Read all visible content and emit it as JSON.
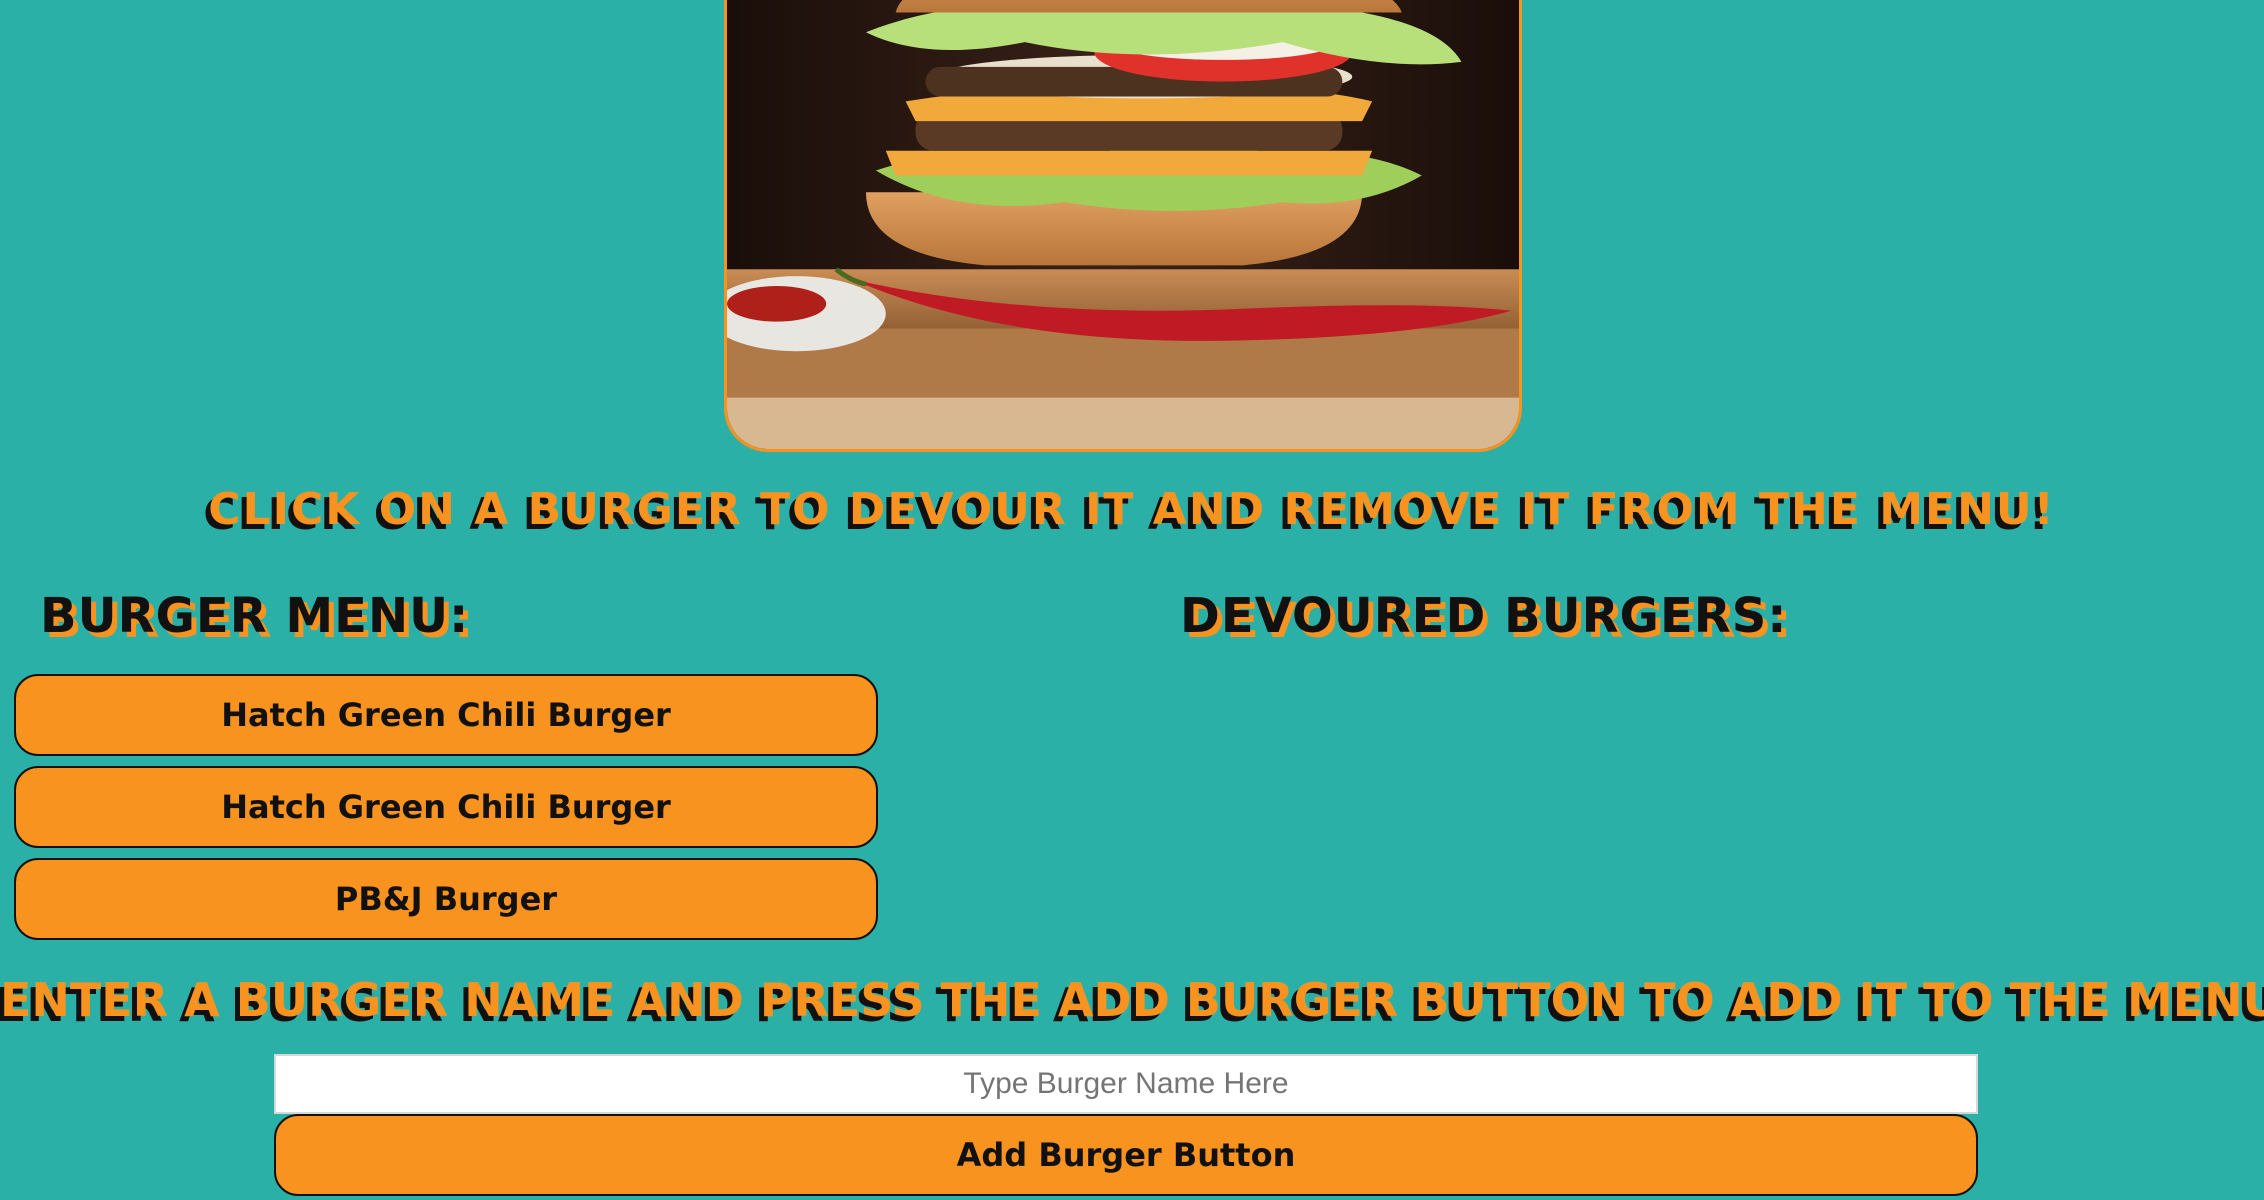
{
  "hero": {
    "image_name": "burger-photo"
  },
  "instructions": {
    "devour_banner": "Click on a burger to devour it and remove it from the menu!",
    "add_banner": "Enter a burger name and press the add burger button to add it to the menu!"
  },
  "menu": {
    "heading": "Burger Menu:",
    "items": [
      {
        "label": "Hatch Green Chili Burger"
      },
      {
        "label": "Hatch Green Chili Burger"
      },
      {
        "label": "PB&J Burger"
      }
    ]
  },
  "devoured": {
    "heading": "Devoured Burgers:",
    "items": []
  },
  "form": {
    "input_placeholder": "Type Burger Name Here",
    "input_value": "",
    "add_button_label": "Add Burger Button"
  },
  "colors": {
    "background": "#2BB0A8",
    "accent_orange": "#F7931E",
    "text_dark": "#111111"
  }
}
